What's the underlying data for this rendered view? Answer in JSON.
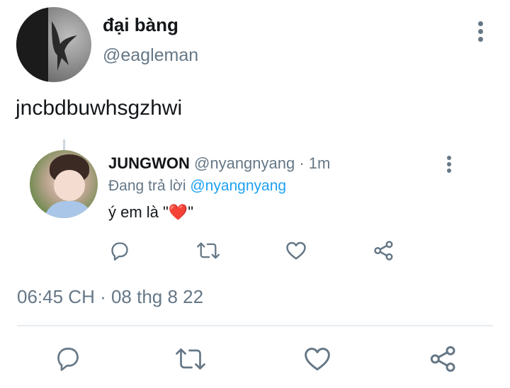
{
  "tweet": {
    "author_name": "đại bàng",
    "author_handle": "@eagleman",
    "text": "jncbdbuwhsgzhwi",
    "timestamp": "06:45 CH · 08 thg 8 22"
  },
  "reply": {
    "author_name": "JUNGWON",
    "author_handle": "@nyangnyang",
    "separator": " · ",
    "time_ago": "1m",
    "replying_prefix": "Đang trả lời ",
    "replying_to": "@nyangnyang",
    "text_before": "ý em là \"",
    "text_emoji": "❤️",
    "text_after": "\""
  },
  "icons": [
    "more-icon",
    "reply-icon",
    "retweet-icon",
    "like-icon",
    "share-icon"
  ],
  "colors": {
    "text_primary": "#14171a",
    "text_secondary": "#657786",
    "link": "#1da1f2",
    "divider": "#e6ecf0"
  }
}
